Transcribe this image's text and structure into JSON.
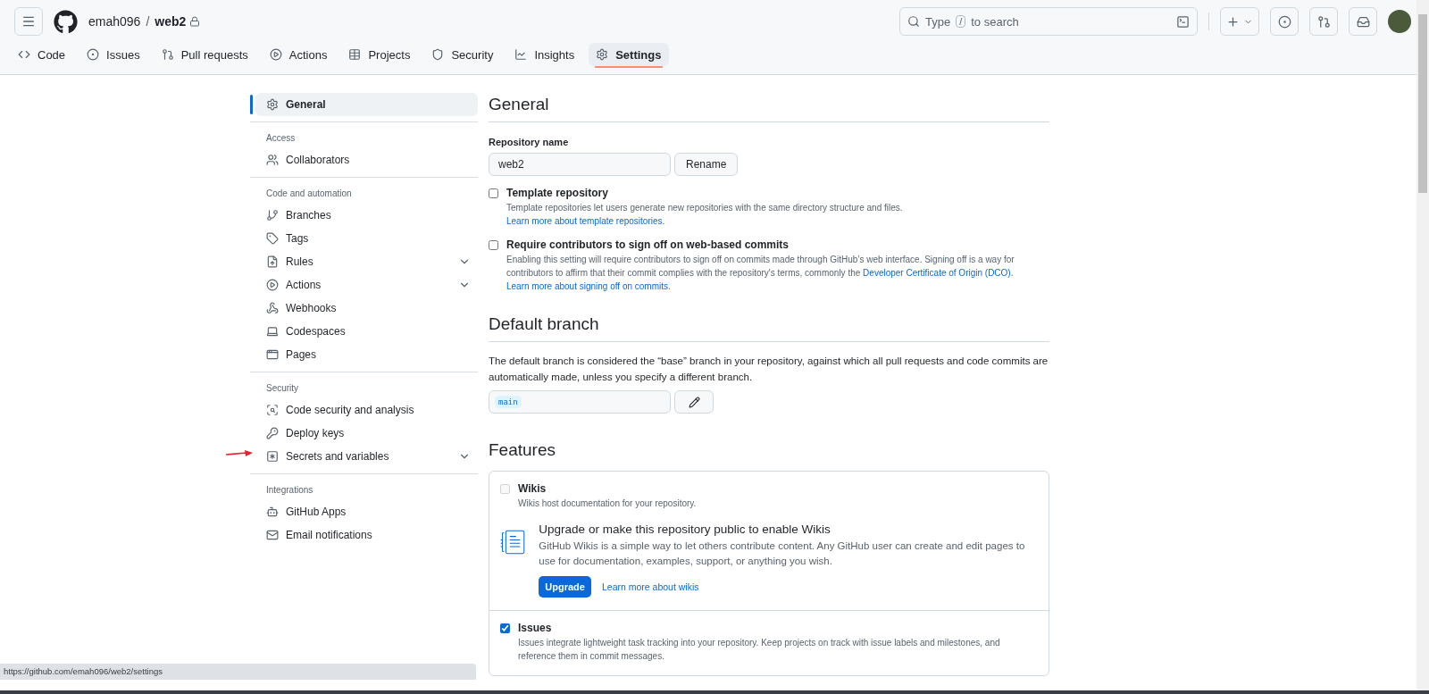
{
  "header": {
    "owner": "emah096",
    "separator": "/",
    "repo": "web2",
    "search": {
      "hint_before": "Type",
      "hint_key": "/",
      "hint_after": "to search"
    }
  },
  "repo_tabs": [
    {
      "label": "Code",
      "selected": false
    },
    {
      "label": "Issues",
      "selected": false
    },
    {
      "label": "Pull requests",
      "selected": false
    },
    {
      "label": "Actions",
      "selected": false
    },
    {
      "label": "Projects",
      "selected": false
    },
    {
      "label": "Security",
      "selected": false
    },
    {
      "label": "Insights",
      "selected": false
    },
    {
      "label": "Settings",
      "selected": true
    }
  ],
  "sidebar": {
    "top_item": {
      "label": "General",
      "selected": true
    },
    "sections": [
      {
        "heading": "Access",
        "items": [
          {
            "label": "Collaborators",
            "expandable": false,
            "selected": false
          }
        ]
      },
      {
        "heading": "Code and automation",
        "items": [
          {
            "label": "Branches",
            "expandable": false,
            "selected": false
          },
          {
            "label": "Tags",
            "expandable": false,
            "selected": false
          },
          {
            "label": "Rules",
            "expandable": true,
            "selected": false
          },
          {
            "label": "Actions",
            "expandable": true,
            "selected": false
          },
          {
            "label": "Webhooks",
            "expandable": false,
            "selected": false
          },
          {
            "label": "Codespaces",
            "expandable": false,
            "selected": false
          },
          {
            "label": "Pages",
            "expandable": false,
            "selected": false
          }
        ]
      },
      {
        "heading": "Security",
        "items": [
          {
            "label": "Code security and analysis",
            "expandable": false,
            "selected": false
          },
          {
            "label": "Deploy keys",
            "expandable": false,
            "selected": false
          },
          {
            "label": "Secrets and variables",
            "expandable": true,
            "selected": false
          }
        ]
      },
      {
        "heading": "Integrations",
        "items": [
          {
            "label": "GitHub Apps",
            "expandable": false,
            "selected": false
          },
          {
            "label": "Email notifications",
            "expandable": false,
            "selected": false
          }
        ]
      }
    ]
  },
  "general": {
    "title": "General",
    "repo_name_label": "Repository name",
    "repo_name_value": "web2",
    "rename_button": "Rename",
    "options": [
      {
        "label": "Template repository",
        "checked": false,
        "description": [
          {
            "text": "Template repositories let users generate new repositories with the same directory structure and files. "
          },
          {
            "link": "Learn more about template repositories"
          },
          {
            "text": "."
          }
        ]
      },
      {
        "label": "Require contributors to sign off on web-based commits",
        "checked": false,
        "description": [
          {
            "text": "Enabling this setting will require contributors to sign off on commits made through GitHub’s web interface. Signing off is a way for contributors to affirm that their commit complies with the repository's terms, commonly the "
          },
          {
            "link": "Developer Certificate of Origin (DCO)"
          },
          {
            "text": ". "
          },
          {
            "link": "Learn more about signing off on commits"
          },
          {
            "text": "."
          }
        ]
      }
    ]
  },
  "default_branch": {
    "title": "Default branch",
    "description": "The default branch is considered the “base” branch in your repository, against which all pull requests and code commits are automatically made, unless you specify a different branch.",
    "branch": "main"
  },
  "features": {
    "title": "Features",
    "wikis": {
      "label": "Wikis",
      "checked": false,
      "disabled": true,
      "description": "Wikis host documentation for your repository.",
      "upsell_title": "Upgrade or make this repository public to enable Wikis",
      "upsell_text": "GitHub Wikis is a simple way to let others contribute content. Any GitHub user can create and edit pages to use for documentation, examples, support, or anything you wish.",
      "upgrade_button": "Upgrade",
      "learn_link": "Learn more about wikis"
    },
    "issues": {
      "label": "Issues",
      "checked": true,
      "disabled": false,
      "description": "Issues integrate lightweight task tracking into your repository. Keep projects on track with issue labels and milestones, and reference them in commit messages."
    }
  },
  "status_bar": {
    "url": "https://github.com/emah096/web2/settings"
  }
}
